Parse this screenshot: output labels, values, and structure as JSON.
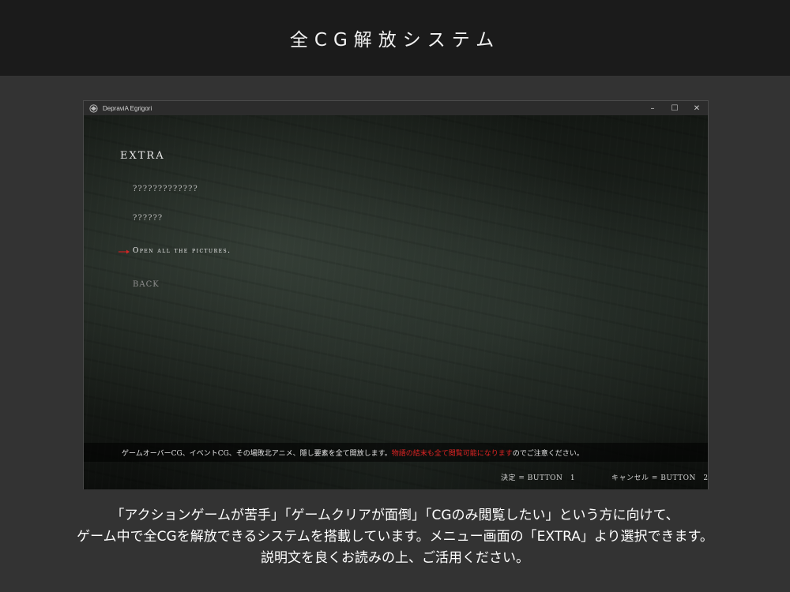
{
  "header": {
    "title": "全CG解放システム"
  },
  "window": {
    "title": "DepraviA Egrigori",
    "controls": {
      "minimize": "–",
      "maximize": "☐",
      "close": "✕"
    }
  },
  "game": {
    "heading": "EXTRA",
    "menu": {
      "item1": "?????????????",
      "item2": "??????",
      "selected": "Open all the pictures.",
      "back": "BACK"
    },
    "description": {
      "before": "ゲームオーバーCG、イベントCG、その場敗北アニメ、隠し要素を全て開放します。",
      "highlight": "物語の結末も全て閲覧可能になります",
      "after": "のでご注意ください。",
      "highlight_color": "#e02424"
    },
    "hints": {
      "confirm": "決定 = BUTTON　1",
      "cancel": "キャンセル = BUTTON　2"
    }
  },
  "caption": {
    "line1": "「アクションゲームが苦手」「ゲームクリアが面倒」「CGのみ閲覧したい」という方に向けて、",
    "line2": "ゲーム中で全CGを解放できるシステムを搭載しています。メニュー画面の「EXTRA」より選択できます。",
    "line3": "説明文を良くお読みの上、ご活用ください。"
  }
}
